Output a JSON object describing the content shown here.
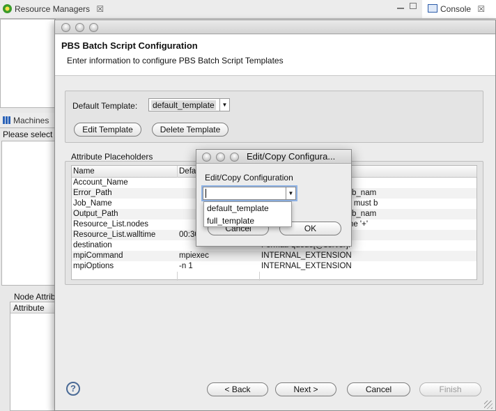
{
  "background": {
    "resource_managers_tab": "Resource Managers",
    "console_tab": "Console",
    "machines_tab": "Machines",
    "machines_hint": "Please select a",
    "node_attributes_label": "Node Attrib",
    "node_attributes_col": "Attribute"
  },
  "wizard": {
    "title": "PBS Batch Script Configuration",
    "description": "Enter information to configure PBS Batch Script Templates",
    "default_template_label": "Default Template:",
    "default_template_value": "default_template",
    "edit_template": "Edit Template",
    "delete_template": "Delete Template",
    "attr_group_label": "Attribute Placeholders",
    "columns": [
      "Name",
      "Defau",
      ""
    ],
    "rows": [
      {
        "name": "Account_Name",
        "default": "",
        "desc": ""
      },
      {
        "name": "Error_Path",
        "default": "",
        "desc": "hname\"; default value: (job_nam"
      },
      {
        "name": "Job_Name",
        "default": "",
        "desc": "characters, first character must b"
      },
      {
        "name": "Output_Path",
        "default": "",
        "desc": "hname\"; default value: (job_nam"
      },
      {
        "name": "Resource_List.nodes",
        "default": "",
        "desc": "node_specs joined with the '+'"
      },
      {
        "name": "Resource_List.walltime",
        "default": "00:30",
        "desc": ":]seconds[.milliseconds]."
      },
      {
        "name": "destination",
        "default": "",
        "desc": "Format: queue[@server]."
      },
      {
        "name": "mpiCommand",
        "default": "mpiexec",
        "desc": "INTERNAL_EXTENSION"
      },
      {
        "name": "mpiOptions",
        "default": "-n 1",
        "desc": "INTERNAL_EXTENSION"
      }
    ],
    "help": "?",
    "back": "< Back",
    "next": "Next >",
    "cancel": "Cancel",
    "finish": "Finish"
  },
  "dialog": {
    "title": "Edit/Copy Configura...",
    "label": "Edit/Copy Configuration",
    "combo_value": "",
    "options": [
      "default_template",
      "full_template"
    ],
    "cancel": "Cancel",
    "ok": "OK"
  }
}
